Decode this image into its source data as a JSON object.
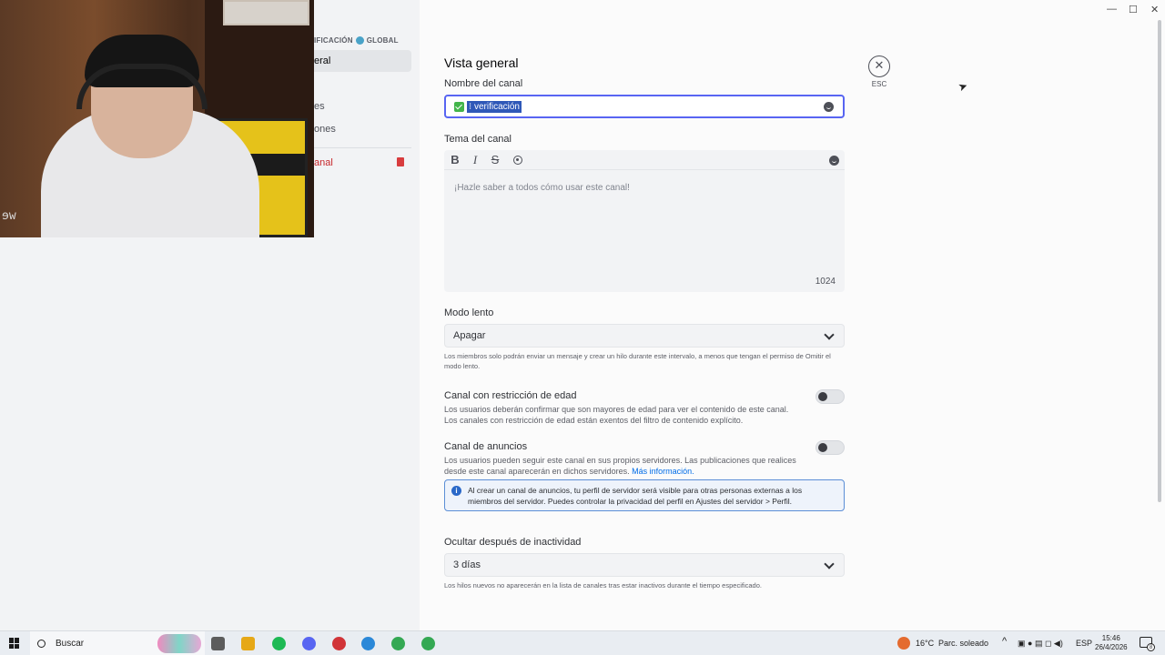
{
  "sidebar": {
    "header": "IFICACIÓN",
    "header_suffix": "GLOBAL",
    "items": [
      {
        "label": "eral"
      },
      {
        "label": "es"
      },
      {
        "label": "ones"
      }
    ],
    "delete_label": "anal"
  },
  "webcam": {
    "overlay_text": "ɘw"
  },
  "main": {
    "title": "Vista general",
    "channel_name": {
      "label": "Nombre del canal",
      "value": "⁝ verificación",
      "prefix_icon": "check-icon"
    },
    "topic": {
      "label": "Tema del canal",
      "placeholder": "¡Hazle saber a todos cómo usar este canal!",
      "char_count": "1024",
      "tools": {
        "bold": "B",
        "italic": "I",
        "strike": "S"
      }
    },
    "slowmode": {
      "label": "Modo lento",
      "value": "Apagar",
      "help_line1": "Los miembros solo podrán enviar un mensaje y crear un hilo durante este intervalo, a menos que tengan el permiso de Omitir el",
      "help_line2": "modo lento."
    },
    "age_restricted": {
      "label": "Canal con restricción de edad",
      "desc_line1": "Los usuarios deberán confirmar que son mayores de edad para ver el contenido de este canal.",
      "desc_line2": "Los canales con restricción de edad están exentos del filtro de contenido explícito.",
      "enabled": false
    },
    "announcement": {
      "label": "Canal de anuncios",
      "desc_line1": "Los usuarios pueden seguir este canal en sus propios servidores. Las publicaciones que realices",
      "desc_line2": "desde este canal aparecerán en dichos servidores.",
      "link": "Más información.",
      "enabled": false,
      "info_line1": "Al crear un canal de anuncios, tu perfil de servidor será visible para otras personas externas a los",
      "info_line2": "miembros del servidor. Puedes controlar la privacidad del perfil en Ajustes del servidor > Perfil."
    },
    "hide_after": {
      "label": "Ocultar después de inactividad",
      "value": "3 días",
      "help": "Los hilos nuevos no aparecerán en la lista de canales tras estar inactivos durante el tiempo especificado."
    },
    "esc": {
      "symbol": "✕",
      "label": "ESC"
    }
  },
  "window_controls": {
    "minimize": "—",
    "maximize": "☐",
    "close": "✕"
  },
  "taskbar": {
    "search_placeholder": "Buscar",
    "weather": "16°C",
    "weather_desc": "Parc. soleado",
    "language": "ESP",
    "time": "15:46",
    "date": "26/4/2026",
    "notifications": "8",
    "tray_chevron": "^",
    "app_colors": [
      "#5c5c5c",
      "#e6a817",
      "#1db954",
      "#5865f2",
      "#d13438",
      "#2b88d8",
      "#34a853",
      "#34a853"
    ]
  }
}
